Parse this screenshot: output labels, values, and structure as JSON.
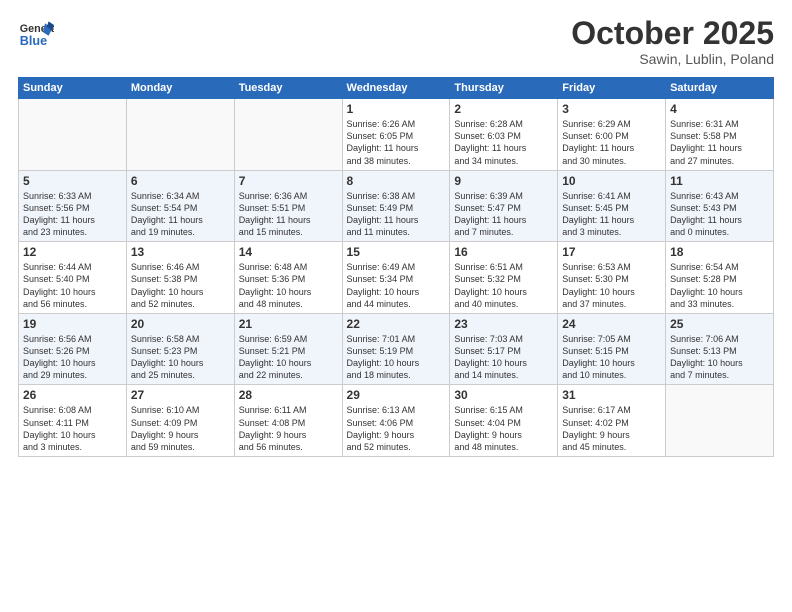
{
  "logo": {
    "line1": "General",
    "line2": "Blue"
  },
  "title": "October 2025",
  "subtitle": "Sawin, Lublin, Poland",
  "headers": [
    "Sunday",
    "Monday",
    "Tuesday",
    "Wednesday",
    "Thursday",
    "Friday",
    "Saturday"
  ],
  "weeks": [
    [
      {
        "num": "",
        "info": ""
      },
      {
        "num": "",
        "info": ""
      },
      {
        "num": "",
        "info": ""
      },
      {
        "num": "1",
        "info": "Sunrise: 6:26 AM\nSunset: 6:05 PM\nDaylight: 11 hours\nand 38 minutes."
      },
      {
        "num": "2",
        "info": "Sunrise: 6:28 AM\nSunset: 6:03 PM\nDaylight: 11 hours\nand 34 minutes."
      },
      {
        "num": "3",
        "info": "Sunrise: 6:29 AM\nSunset: 6:00 PM\nDaylight: 11 hours\nand 30 minutes."
      },
      {
        "num": "4",
        "info": "Sunrise: 6:31 AM\nSunset: 5:58 PM\nDaylight: 11 hours\nand 27 minutes."
      }
    ],
    [
      {
        "num": "5",
        "info": "Sunrise: 6:33 AM\nSunset: 5:56 PM\nDaylight: 11 hours\nand 23 minutes."
      },
      {
        "num": "6",
        "info": "Sunrise: 6:34 AM\nSunset: 5:54 PM\nDaylight: 11 hours\nand 19 minutes."
      },
      {
        "num": "7",
        "info": "Sunrise: 6:36 AM\nSunset: 5:51 PM\nDaylight: 11 hours\nand 15 minutes."
      },
      {
        "num": "8",
        "info": "Sunrise: 6:38 AM\nSunset: 5:49 PM\nDaylight: 11 hours\nand 11 minutes."
      },
      {
        "num": "9",
        "info": "Sunrise: 6:39 AM\nSunset: 5:47 PM\nDaylight: 11 hours\nand 7 minutes."
      },
      {
        "num": "10",
        "info": "Sunrise: 6:41 AM\nSunset: 5:45 PM\nDaylight: 11 hours\nand 3 minutes."
      },
      {
        "num": "11",
        "info": "Sunrise: 6:43 AM\nSunset: 5:43 PM\nDaylight: 11 hours\nand 0 minutes."
      }
    ],
    [
      {
        "num": "12",
        "info": "Sunrise: 6:44 AM\nSunset: 5:40 PM\nDaylight: 10 hours\nand 56 minutes."
      },
      {
        "num": "13",
        "info": "Sunrise: 6:46 AM\nSunset: 5:38 PM\nDaylight: 10 hours\nand 52 minutes."
      },
      {
        "num": "14",
        "info": "Sunrise: 6:48 AM\nSunset: 5:36 PM\nDaylight: 10 hours\nand 48 minutes."
      },
      {
        "num": "15",
        "info": "Sunrise: 6:49 AM\nSunset: 5:34 PM\nDaylight: 10 hours\nand 44 minutes."
      },
      {
        "num": "16",
        "info": "Sunrise: 6:51 AM\nSunset: 5:32 PM\nDaylight: 10 hours\nand 40 minutes."
      },
      {
        "num": "17",
        "info": "Sunrise: 6:53 AM\nSunset: 5:30 PM\nDaylight: 10 hours\nand 37 minutes."
      },
      {
        "num": "18",
        "info": "Sunrise: 6:54 AM\nSunset: 5:28 PM\nDaylight: 10 hours\nand 33 minutes."
      }
    ],
    [
      {
        "num": "19",
        "info": "Sunrise: 6:56 AM\nSunset: 5:26 PM\nDaylight: 10 hours\nand 29 minutes."
      },
      {
        "num": "20",
        "info": "Sunrise: 6:58 AM\nSunset: 5:23 PM\nDaylight: 10 hours\nand 25 minutes."
      },
      {
        "num": "21",
        "info": "Sunrise: 6:59 AM\nSunset: 5:21 PM\nDaylight: 10 hours\nand 22 minutes."
      },
      {
        "num": "22",
        "info": "Sunrise: 7:01 AM\nSunset: 5:19 PM\nDaylight: 10 hours\nand 18 minutes."
      },
      {
        "num": "23",
        "info": "Sunrise: 7:03 AM\nSunset: 5:17 PM\nDaylight: 10 hours\nand 14 minutes."
      },
      {
        "num": "24",
        "info": "Sunrise: 7:05 AM\nSunset: 5:15 PM\nDaylight: 10 hours\nand 10 minutes."
      },
      {
        "num": "25",
        "info": "Sunrise: 7:06 AM\nSunset: 5:13 PM\nDaylight: 10 hours\nand 7 minutes."
      }
    ],
    [
      {
        "num": "26",
        "info": "Sunrise: 6:08 AM\nSunset: 4:11 PM\nDaylight: 10 hours\nand 3 minutes."
      },
      {
        "num": "27",
        "info": "Sunrise: 6:10 AM\nSunset: 4:09 PM\nDaylight: 9 hours\nand 59 minutes."
      },
      {
        "num": "28",
        "info": "Sunrise: 6:11 AM\nSunset: 4:08 PM\nDaylight: 9 hours\nand 56 minutes."
      },
      {
        "num": "29",
        "info": "Sunrise: 6:13 AM\nSunset: 4:06 PM\nDaylight: 9 hours\nand 52 minutes."
      },
      {
        "num": "30",
        "info": "Sunrise: 6:15 AM\nSunset: 4:04 PM\nDaylight: 9 hours\nand 48 minutes."
      },
      {
        "num": "31",
        "info": "Sunrise: 6:17 AM\nSunset: 4:02 PM\nDaylight: 9 hours\nand 45 minutes."
      },
      {
        "num": "",
        "info": ""
      }
    ]
  ]
}
